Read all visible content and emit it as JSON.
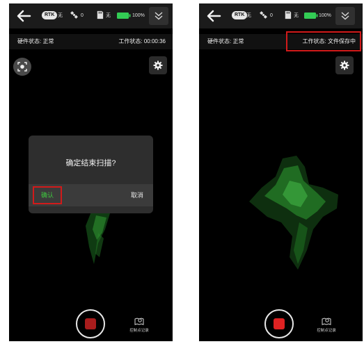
{
  "statusbar": {
    "rtk_label": "RTK",
    "rtk_value": "无",
    "satellite_count": "0",
    "storage_value": "无",
    "battery_percent": "100%",
    "battery_color": "#33cc55"
  },
  "left_screen": {
    "hardware_status": "硬件状态: 正常",
    "work_status": "工作状态: 00:00:36",
    "dialog": {
      "message": "确定结束扫描?",
      "confirm_label": "确认",
      "cancel_label": "取消"
    },
    "record_color": "#a81c1c",
    "control_point_label": "控制点记录"
  },
  "right_screen": {
    "hardware_status": "硬件状态: 正常",
    "work_status": "工作状态: 文件保存中",
    "record_color": "#e02222",
    "control_point_label": "控制点记录"
  },
  "colors": {
    "highlight_border": "#d21a1a",
    "confirm_text": "#3ec83e"
  }
}
